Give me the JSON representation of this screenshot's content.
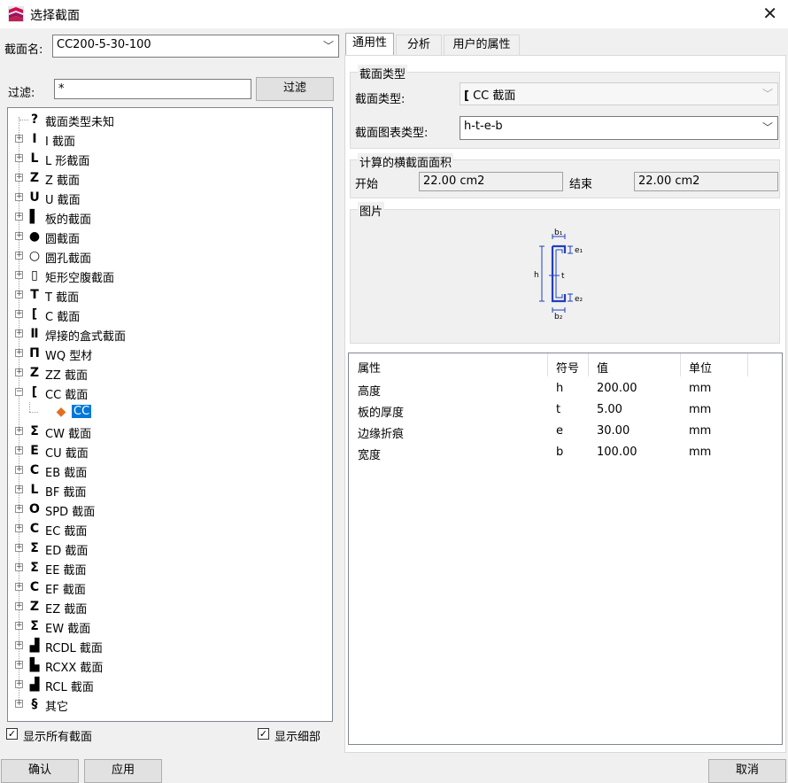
{
  "window": {
    "title": "选择截面",
    "close": "✕"
  },
  "section_name": {
    "label": "截面名:",
    "value": "CC200-5-30-100"
  },
  "filter": {
    "label": "过滤:",
    "value": "*",
    "button": "过滤"
  },
  "tree": [
    {
      "label": "截面类型未知",
      "icon": "?"
    },
    {
      "label": "I 截面",
      "icon": "I"
    },
    {
      "label": "L 形截面",
      "icon": "L"
    },
    {
      "label": "Z 截面",
      "icon": "Z"
    },
    {
      "label": "U 截面",
      "icon": "U"
    },
    {
      "label": "板的截面",
      "icon": "▌"
    },
    {
      "label": "圆截面",
      "icon": "●"
    },
    {
      "label": "圆孔截面",
      "icon": "○"
    },
    {
      "label": "矩形空腹截面",
      "icon": "▯"
    },
    {
      "label": "T 截面",
      "icon": "T"
    },
    {
      "label": "C 截面",
      "icon": "["
    },
    {
      "label": "焊接的盒式截面",
      "icon": "Ⅱ"
    },
    {
      "label": "WQ 型材",
      "icon": "Π"
    },
    {
      "label": "ZZ 截面",
      "icon": "Z"
    },
    {
      "label": "CC 截面",
      "icon": "["
    },
    {
      "label": "CC",
      "icon": "◆"
    },
    {
      "label": "CW 截面",
      "icon": "Σ"
    },
    {
      "label": "CU 截面",
      "icon": "E"
    },
    {
      "label": "EB 截面",
      "icon": "C"
    },
    {
      "label": "BF 截面",
      "icon": "L"
    },
    {
      "label": "SPD 截面",
      "icon": "O"
    },
    {
      "label": "EC 截面",
      "icon": "C"
    },
    {
      "label": "ED 截面",
      "icon": "Σ"
    },
    {
      "label": "EE 截面",
      "icon": "Σ"
    },
    {
      "label": "EF 截面",
      "icon": "C"
    },
    {
      "label": "EZ 截面",
      "icon": "Z"
    },
    {
      "label": "EW 截面",
      "icon": "Σ"
    },
    {
      "label": "RCDL 截面",
      "icon": "▟"
    },
    {
      "label": "RCXX 截面",
      "icon": "▙"
    },
    {
      "label": "RCL 截面",
      "icon": "▟"
    },
    {
      "label": "其它",
      "icon": "§"
    }
  ],
  "show_all": {
    "label": "显示所有截面",
    "checked": "✓"
  },
  "show_detail": {
    "label": "显示细部",
    "checked": "✓"
  },
  "tabs": [
    "通用性",
    "分析",
    "用户的属性"
  ],
  "section_type_group": {
    "title": "截面类型",
    "type_label": "截面类型:",
    "type_value": "CC 截面",
    "chart_label": "截面图表类型:",
    "chart_value": "h-t-e-b"
  },
  "area_group": {
    "title": "计算的横截面面积",
    "start_label": "开始",
    "start_value": "22.00 cm2",
    "end_label": "结束",
    "end_value": "22.00 cm2"
  },
  "picture": {
    "title": "图片",
    "h": "h",
    "t": "t",
    "b1": "b₁",
    "b2": "b₂",
    "e1": "e₁",
    "e2": "e₂"
  },
  "properties": {
    "headers": [
      "属性",
      "符号",
      "值",
      "单位"
    ],
    "rows": [
      [
        "高度",
        "h",
        "200.00",
        "mm"
      ],
      [
        "板的厚度",
        "t",
        "5.00",
        "mm"
      ],
      [
        "边缘折痕",
        "e",
        "30.00",
        "mm"
      ],
      [
        "宽度",
        "b",
        "100.00",
        "mm"
      ]
    ]
  },
  "buttons": {
    "ok": "确认",
    "apply": "应用",
    "cancel": "取消"
  },
  "colors": {
    "selection": "#0078d7",
    "blueprint": "#1f3fbf"
  }
}
